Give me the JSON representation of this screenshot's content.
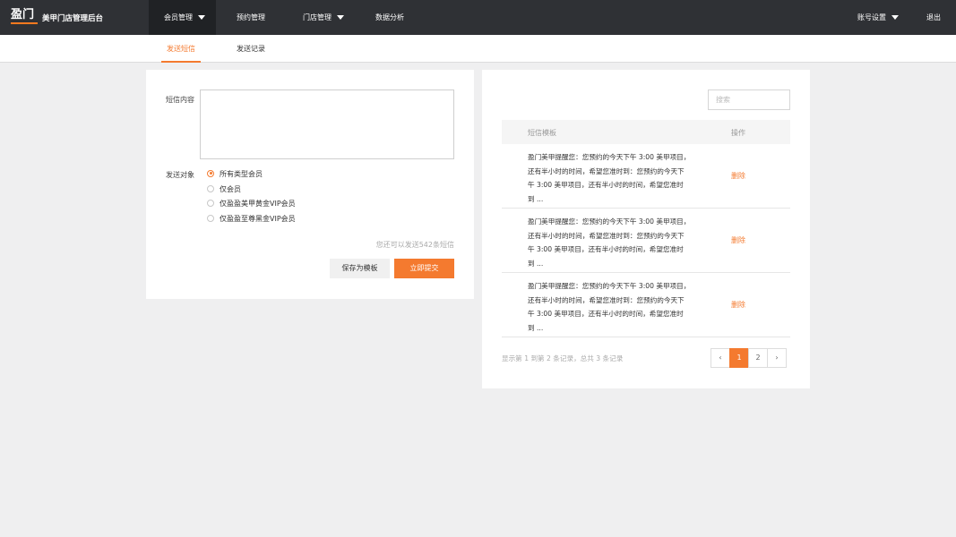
{
  "app": {
    "logo_text": "盈门",
    "title": "美甲门店管理后台"
  },
  "nav": {
    "items": [
      {
        "label": "会员管理",
        "has_caret": true,
        "active": true
      },
      {
        "label": "预约管理",
        "has_caret": false
      },
      {
        "label": "门店管理",
        "has_caret": true
      },
      {
        "label": "数据分析",
        "has_caret": false
      }
    ],
    "account_label": "账号设置",
    "logout_label": "退出"
  },
  "subtabs": [
    {
      "label": "发送短信",
      "active": true
    },
    {
      "label": "发送记录",
      "active": false
    }
  ],
  "form": {
    "content_label": "短信内容",
    "content_value": "",
    "target_label": "发送对象",
    "options": [
      {
        "label": "所有类型会员",
        "checked": true
      },
      {
        "label": "仅会员",
        "checked": false
      },
      {
        "label": "仅盈盈美甲黄金VIP会员",
        "checked": false
      },
      {
        "label": "仅盈盈至尊黑金VIP会员",
        "checked": false
      }
    ],
    "remaining_hint": "您还可以发送542条短信",
    "save_template_label": "保存为模板",
    "submit_label": "立即提交"
  },
  "templates": {
    "search_placeholder": "搜索",
    "col_template": "短信模板",
    "col_action": "操作",
    "rows": [
      {
        "line1": "盈门美甲提醒您：您预约的今天下午 3:00 美甲项目，",
        "line2": "还有半小时的时间，希望您准时到：您预约的今天下",
        "line3": "午 3:00 美甲项目，还有半小时的时间，希望您准时",
        "line4": "到 ...",
        "action": "删除"
      },
      {
        "line1": "盈门美甲提醒您：您预约的今天下午 3:00 美甲项目，",
        "line2": "还有半小时的时间，希望您准时到：您预约的今天下",
        "line3": "午 3:00 美甲项目，还有半小时的时间，希望您准时",
        "line4": "到 ...",
        "action": "删除"
      },
      {
        "line1": "盈门美甲提醒您：您预约的今天下午 3:00 美甲项目，",
        "line2": "还有半小时的时间，希望您准时到：您预约的今天下",
        "line3": "午 3:00 美甲项目，还有半小时的时间，希望您准时",
        "line4": "到 ...",
        "action": "删除"
      }
    ],
    "footer": "显示第 1 到第 2 条记录，总共 3 条记录",
    "pager": {
      "prev": "‹",
      "pages": [
        "1",
        "2"
      ],
      "active_page": "1",
      "next": "›"
    }
  },
  "colors": {
    "accent": "#f47a2f",
    "topbar": "#2f3135",
    "background": "#efeff0"
  }
}
